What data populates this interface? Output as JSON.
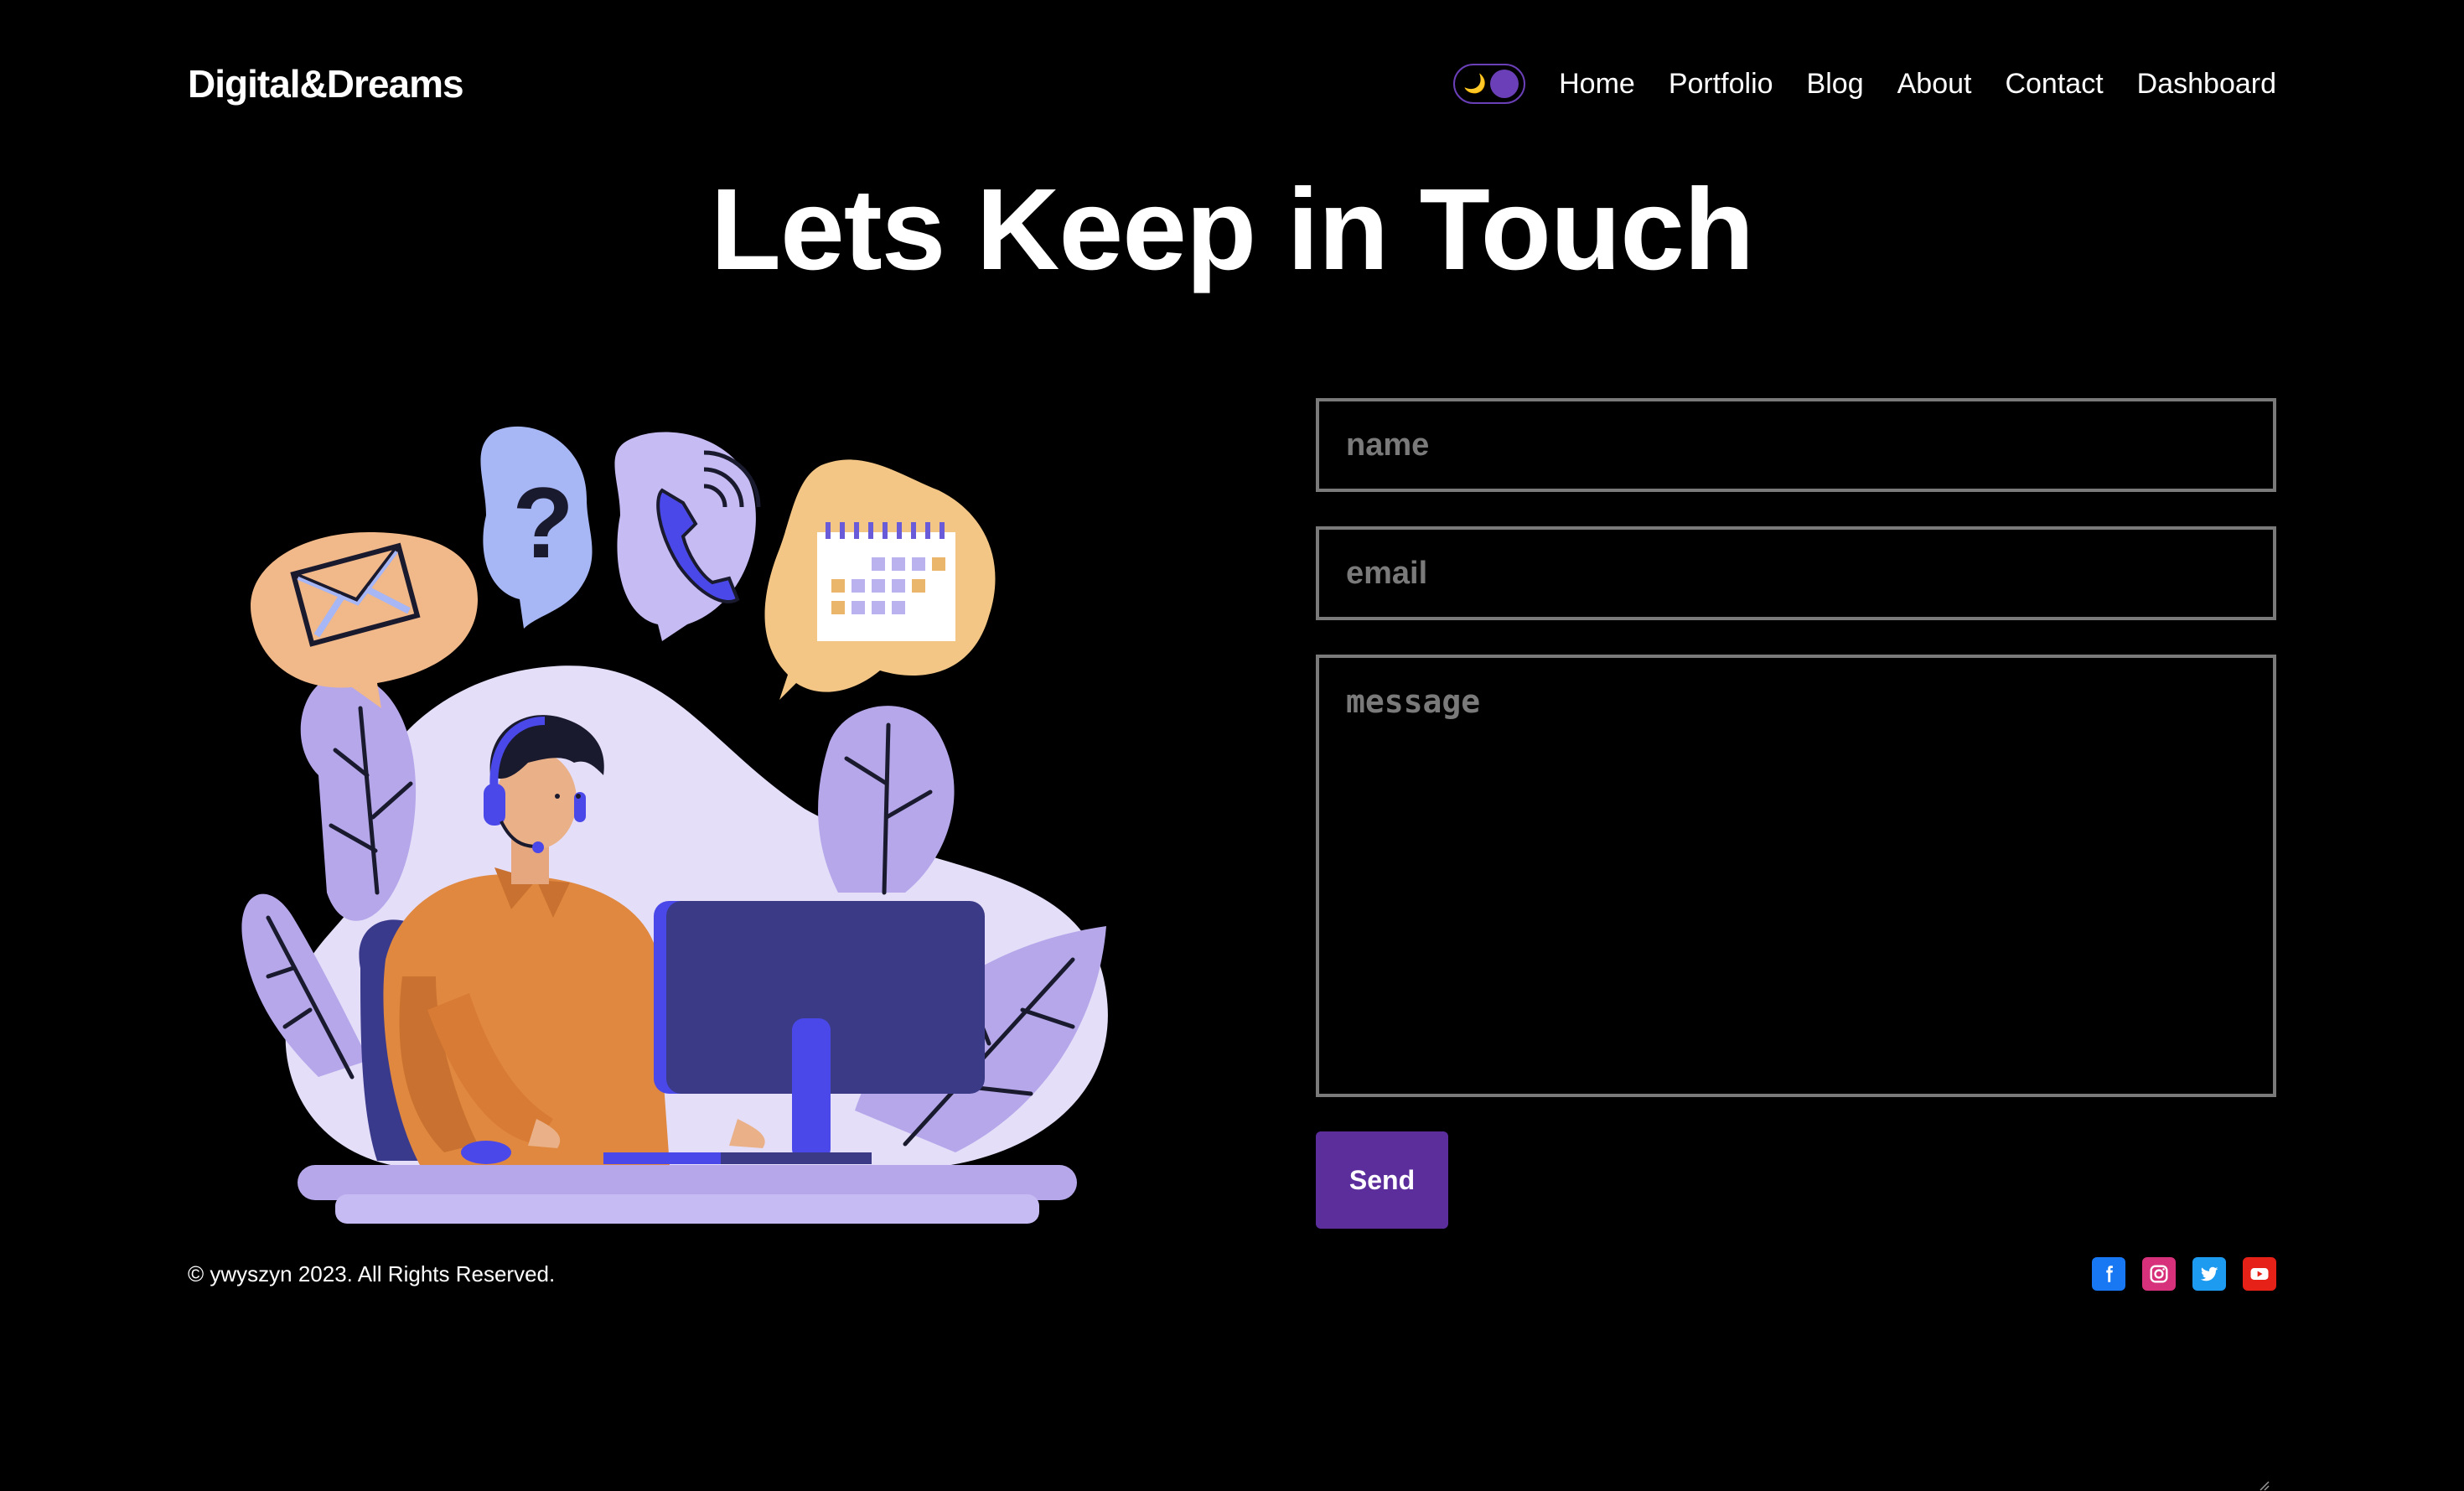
{
  "header": {
    "logo": "Digital&Dreams",
    "theme_toggle": {
      "icon": "moon-icon",
      "glyph": "🌙",
      "state": "dark"
    },
    "nav": [
      {
        "label": "Home"
      },
      {
        "label": "Portfolio"
      },
      {
        "label": "Blog"
      },
      {
        "label": "About"
      },
      {
        "label": "Contact"
      },
      {
        "label": "Dashboard"
      }
    ]
  },
  "main": {
    "title": "Lets Keep in Touch",
    "form": {
      "name_placeholder": "name",
      "name_value": "",
      "email_placeholder": "email",
      "email_value": "",
      "message_placeholder": "message",
      "message_value": "",
      "send_label": "Send"
    }
  },
  "footer": {
    "copyright": "© ywyszyn 2023. All Rights Reserved.",
    "socials": [
      {
        "name": "facebook",
        "icon": "facebook-icon",
        "color": "#1877f2"
      },
      {
        "name": "instagram",
        "icon": "instagram-icon",
        "color": "#d6317a"
      },
      {
        "name": "twitter",
        "icon": "twitter-icon",
        "color": "#1d9bf0"
      },
      {
        "name": "youtube",
        "icon": "youtube-icon",
        "color": "#e62117"
      }
    ]
  },
  "colors": {
    "background": "#000000",
    "accent": "#5b2e9c",
    "field_border": "#7a7a7a"
  }
}
